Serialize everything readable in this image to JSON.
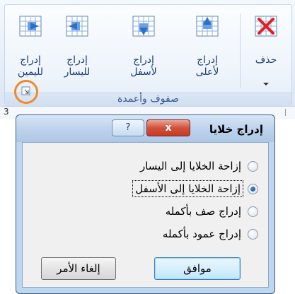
{
  "ribbon": {
    "buttons": [
      {
        "id": "delete",
        "lines": [
          "حذف"
        ],
        "icon": "delete-x-icon"
      },
      {
        "id": "insert-above",
        "lines": [
          "إدراج",
          "لأعلى"
        ],
        "icon": "insert-above-icon"
      },
      {
        "id": "insert-below",
        "lines": [
          "إدراج",
          "لأسفل"
        ],
        "icon": "insert-below-icon"
      },
      {
        "id": "insert-left",
        "lines": [
          "إدراج",
          "لليسار"
        ],
        "icon": "insert-left-icon"
      },
      {
        "id": "insert-right",
        "lines": [
          "إدراج",
          "لليمين"
        ],
        "icon": "insert-right-icon"
      }
    ],
    "group_title": "صفوف وأعمدة",
    "launcher_icon": "dialog-launcher-icon",
    "highlight_color": "#f08a24"
  },
  "sheet": {
    "column_number": "3"
  },
  "dialog": {
    "title": "إدراج خلايا",
    "help_label": "?",
    "close_label": "x",
    "options": [
      {
        "label": "إزاحة الخلايا إلى اليسار",
        "checked": false
      },
      {
        "label": "إزاحة الخلايا إلى الأسفل",
        "checked": true
      },
      {
        "label": "إدراج صف بأكمله",
        "checked": false
      },
      {
        "label": "إدراج عمود بأكمله",
        "checked": false
      }
    ],
    "ok_label": "موافق",
    "cancel_label": "إلغاء الأمر"
  }
}
